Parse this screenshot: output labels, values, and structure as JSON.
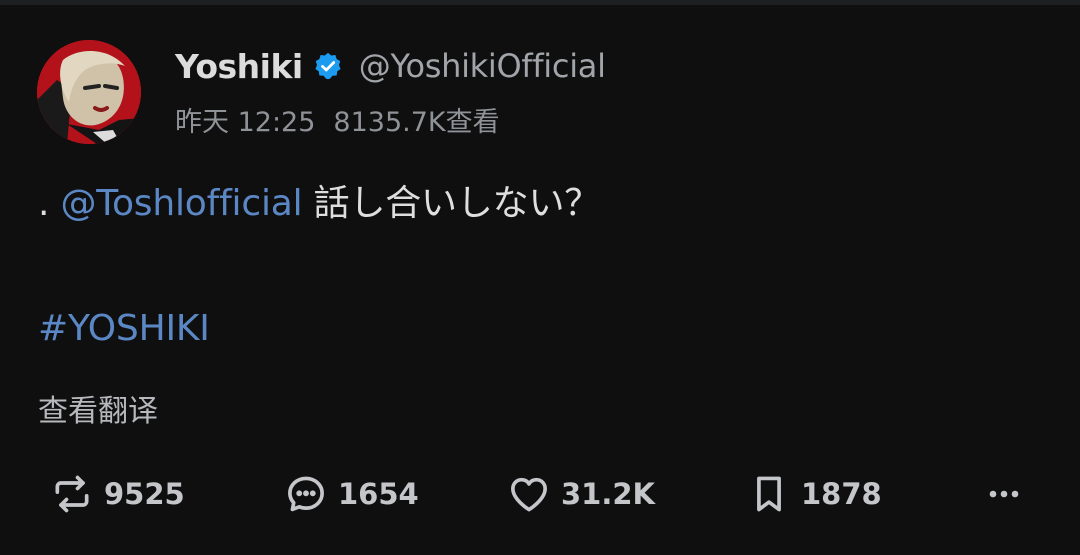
{
  "author": {
    "display_name": "Yoshiki",
    "handle": "@YoshikiOfficial",
    "verified": true
  },
  "meta": {
    "time": "昨天 12:25",
    "views": "8135.7K查看"
  },
  "tweet": {
    "prefix": ". ",
    "mention": "@Toshlofficial",
    "text": " 話し合いしない？",
    "hashtag": "#YOSHIKI"
  },
  "translate_label": "查看翻译",
  "actions": {
    "retweets": "9525",
    "replies": "1654",
    "likes": "31.2K",
    "bookmarks": "1878"
  },
  "colors": {
    "background": "#0f0f10",
    "link": "#5b88c4",
    "verified_badge": "#1d9bf0",
    "avatar_bg": "#b3121b"
  },
  "icons": [
    "verified-badge-icon",
    "retweet-icon",
    "reply-icon",
    "like-icon",
    "bookmark-icon",
    "more-icon"
  ]
}
